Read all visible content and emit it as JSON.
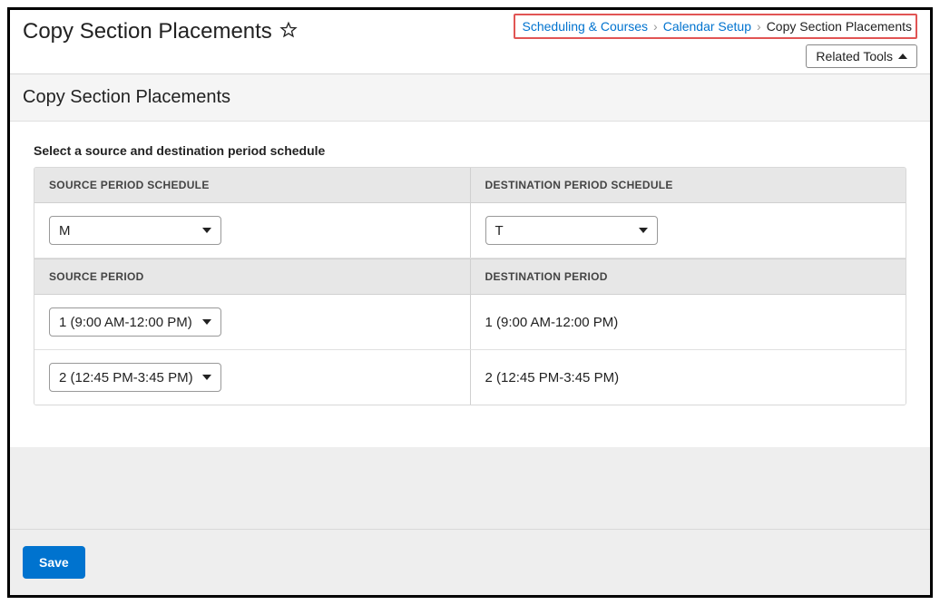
{
  "header": {
    "title": "Copy Section Placements",
    "breadcrumb": {
      "link1": "Scheduling & Courses",
      "link2": "Calendar Setup",
      "current": "Copy Section Placements"
    },
    "related_tools_label": "Related Tools"
  },
  "subheader": {
    "title": "Copy Section Placements"
  },
  "prompt": "Select a source and destination period schedule",
  "table": {
    "header1": "SOURCE PERIOD SCHEDULE",
    "header2": "DESTINATION PERIOD SCHEDULE",
    "schedule_source": "M",
    "schedule_dest": "T",
    "subheader1": "SOURCE PERIOD",
    "subheader2": "DESTINATION PERIOD",
    "rows": [
      {
        "source": "1 (9:00 AM-12:00 PM)",
        "dest": "1 (9:00 AM-12:00 PM)"
      },
      {
        "source": "2 (12:45 PM-3:45 PM)",
        "dest": "2 (12:45 PM-3:45 PM)"
      }
    ]
  },
  "footer": {
    "save_label": "Save"
  }
}
